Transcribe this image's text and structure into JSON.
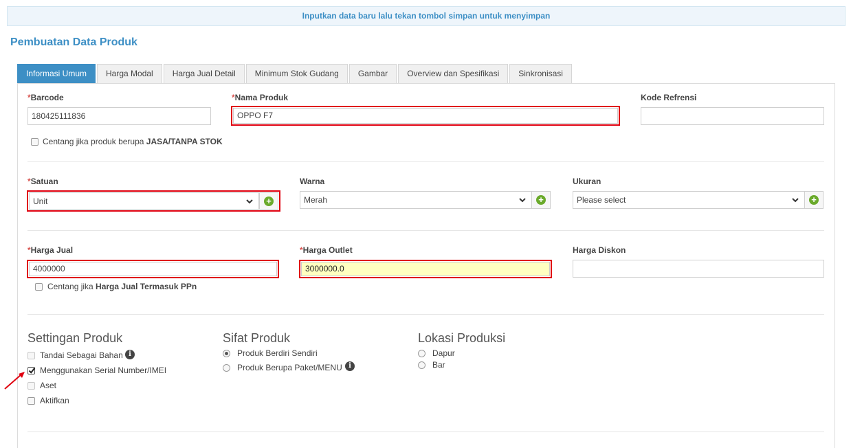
{
  "notice": "Inputkan data baru lalu tekan tombol simpan untuk menyimpan",
  "page_title": "Pembuatan Data Produk",
  "tabs": [
    {
      "label": "Informasi Umum",
      "active": true
    },
    {
      "label": "Harga Modal"
    },
    {
      "label": "Harga Jual Detail"
    },
    {
      "label": "Minimum Stok Gudang"
    },
    {
      "label": "Gambar"
    },
    {
      "label": "Overview dan Spesifikasi"
    },
    {
      "label": "Sinkronisasi"
    }
  ],
  "required_mark": "*",
  "fields": {
    "barcode": {
      "label": "Barcode",
      "value": "180425111836"
    },
    "nama_produk": {
      "label": "Nama Produk",
      "value": "OPPO F7"
    },
    "kode_refrensi": {
      "label": "Kode Refrensi",
      "value": ""
    },
    "jasa_checkbox": {
      "prefix": "Centang jika produk berupa ",
      "bold": "JASA/TANPA STOK"
    },
    "satuan": {
      "label": "Satuan",
      "value": "Unit"
    },
    "warna": {
      "label": "Warna",
      "value": "Merah"
    },
    "ukuran": {
      "label": "Ukuran",
      "value": "Please select"
    },
    "harga_jual": {
      "label": "Harga Jual",
      "value": "4000000"
    },
    "harga_outlet": {
      "label": "Harga Outlet",
      "value": "3000000.0"
    },
    "harga_diskon": {
      "label": "Harga Diskon",
      "value": ""
    },
    "ppn_checkbox": {
      "prefix": "Centang jika ",
      "bold": "Harga Jual Termasuk PPn"
    }
  },
  "settingan": {
    "title": "Settingan Produk",
    "options": [
      {
        "label": "Tandai Sebagai Bahan",
        "checked": false
      },
      {
        "label": "Menggunakan Serial Number/IMEI",
        "checked": true
      },
      {
        "label": "Aset",
        "checked": false
      },
      {
        "label": "Aktifkan",
        "checked": false
      }
    ]
  },
  "sifat": {
    "title": "Sifat Produk",
    "options": [
      {
        "label": "Produk Berdiri Sendiri",
        "selected": true
      },
      {
        "label": "Produk Berupa Paket/MENU",
        "selected": false
      }
    ]
  },
  "lokasi": {
    "title": "Lokasi Produksi",
    "options": [
      {
        "label": "Dapur",
        "selected": false
      },
      {
        "label": "Bar",
        "selected": false
      }
    ]
  },
  "info_glyph": "i",
  "colors": {
    "accent": "#3d8fc5",
    "highlight": "#e0000f",
    "add": "#6aaa2b",
    "outlet_bg": "#ffffc0"
  }
}
